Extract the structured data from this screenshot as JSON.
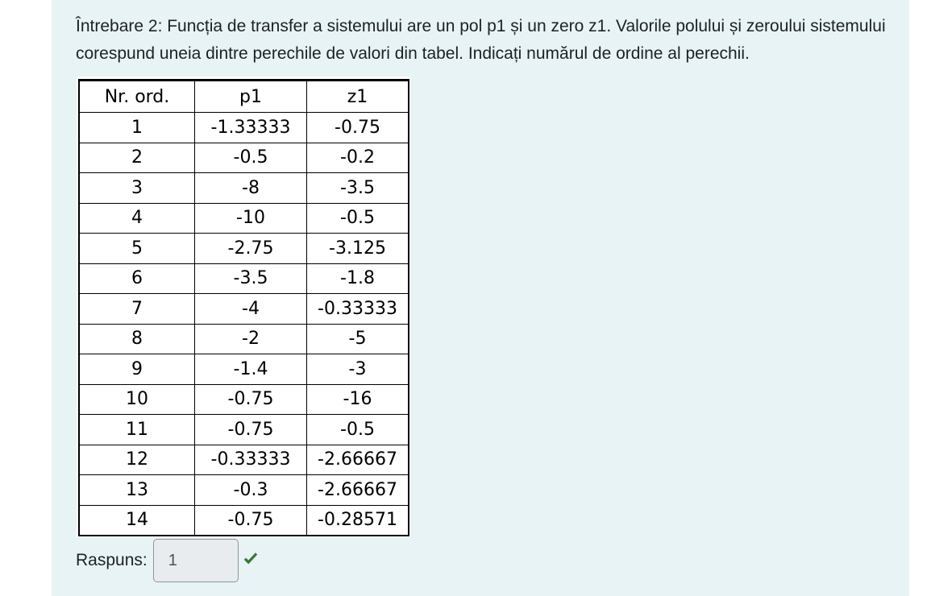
{
  "question": {
    "text": "Întrebare 2: Funcția de transfer a sistemului are un pol p1 și un zero z1. Valorile polului și zeroului sistemului corespund uneia dintre perechile de valori din tabel. Indicați numărul de ordine al perechii."
  },
  "table": {
    "headers": [
      "Nr. ord.",
      "p1",
      "z1"
    ],
    "rows": [
      [
        "1",
        "-1.33333",
        "-0.75"
      ],
      [
        "2",
        "-0.5",
        "-0.2"
      ],
      [
        "3",
        "-8",
        "-3.5"
      ],
      [
        "4",
        "-10",
        "-0.5"
      ],
      [
        "5",
        "-2.75",
        "-3.125"
      ],
      [
        "6",
        "-3.5",
        "-1.8"
      ],
      [
        "7",
        "-4",
        "-0.33333"
      ],
      [
        "8",
        "-2",
        "-5"
      ],
      [
        "9",
        "-1.4",
        "-3"
      ],
      [
        "10",
        "-0.75",
        "-16"
      ],
      [
        "11",
        "-0.75",
        "-0.5"
      ],
      [
        "12",
        "-0.33333",
        "-2.66667"
      ],
      [
        "13",
        "-0.3",
        "-2.66667"
      ],
      [
        "14",
        "-0.75",
        "-0.28571"
      ]
    ]
  },
  "answer": {
    "label": "Raspuns:",
    "value": "1",
    "status_icon": "check-icon",
    "status_color": "#357a32"
  },
  "colors": {
    "panel_background": "#e7f3f5",
    "text": "#1d2125"
  }
}
